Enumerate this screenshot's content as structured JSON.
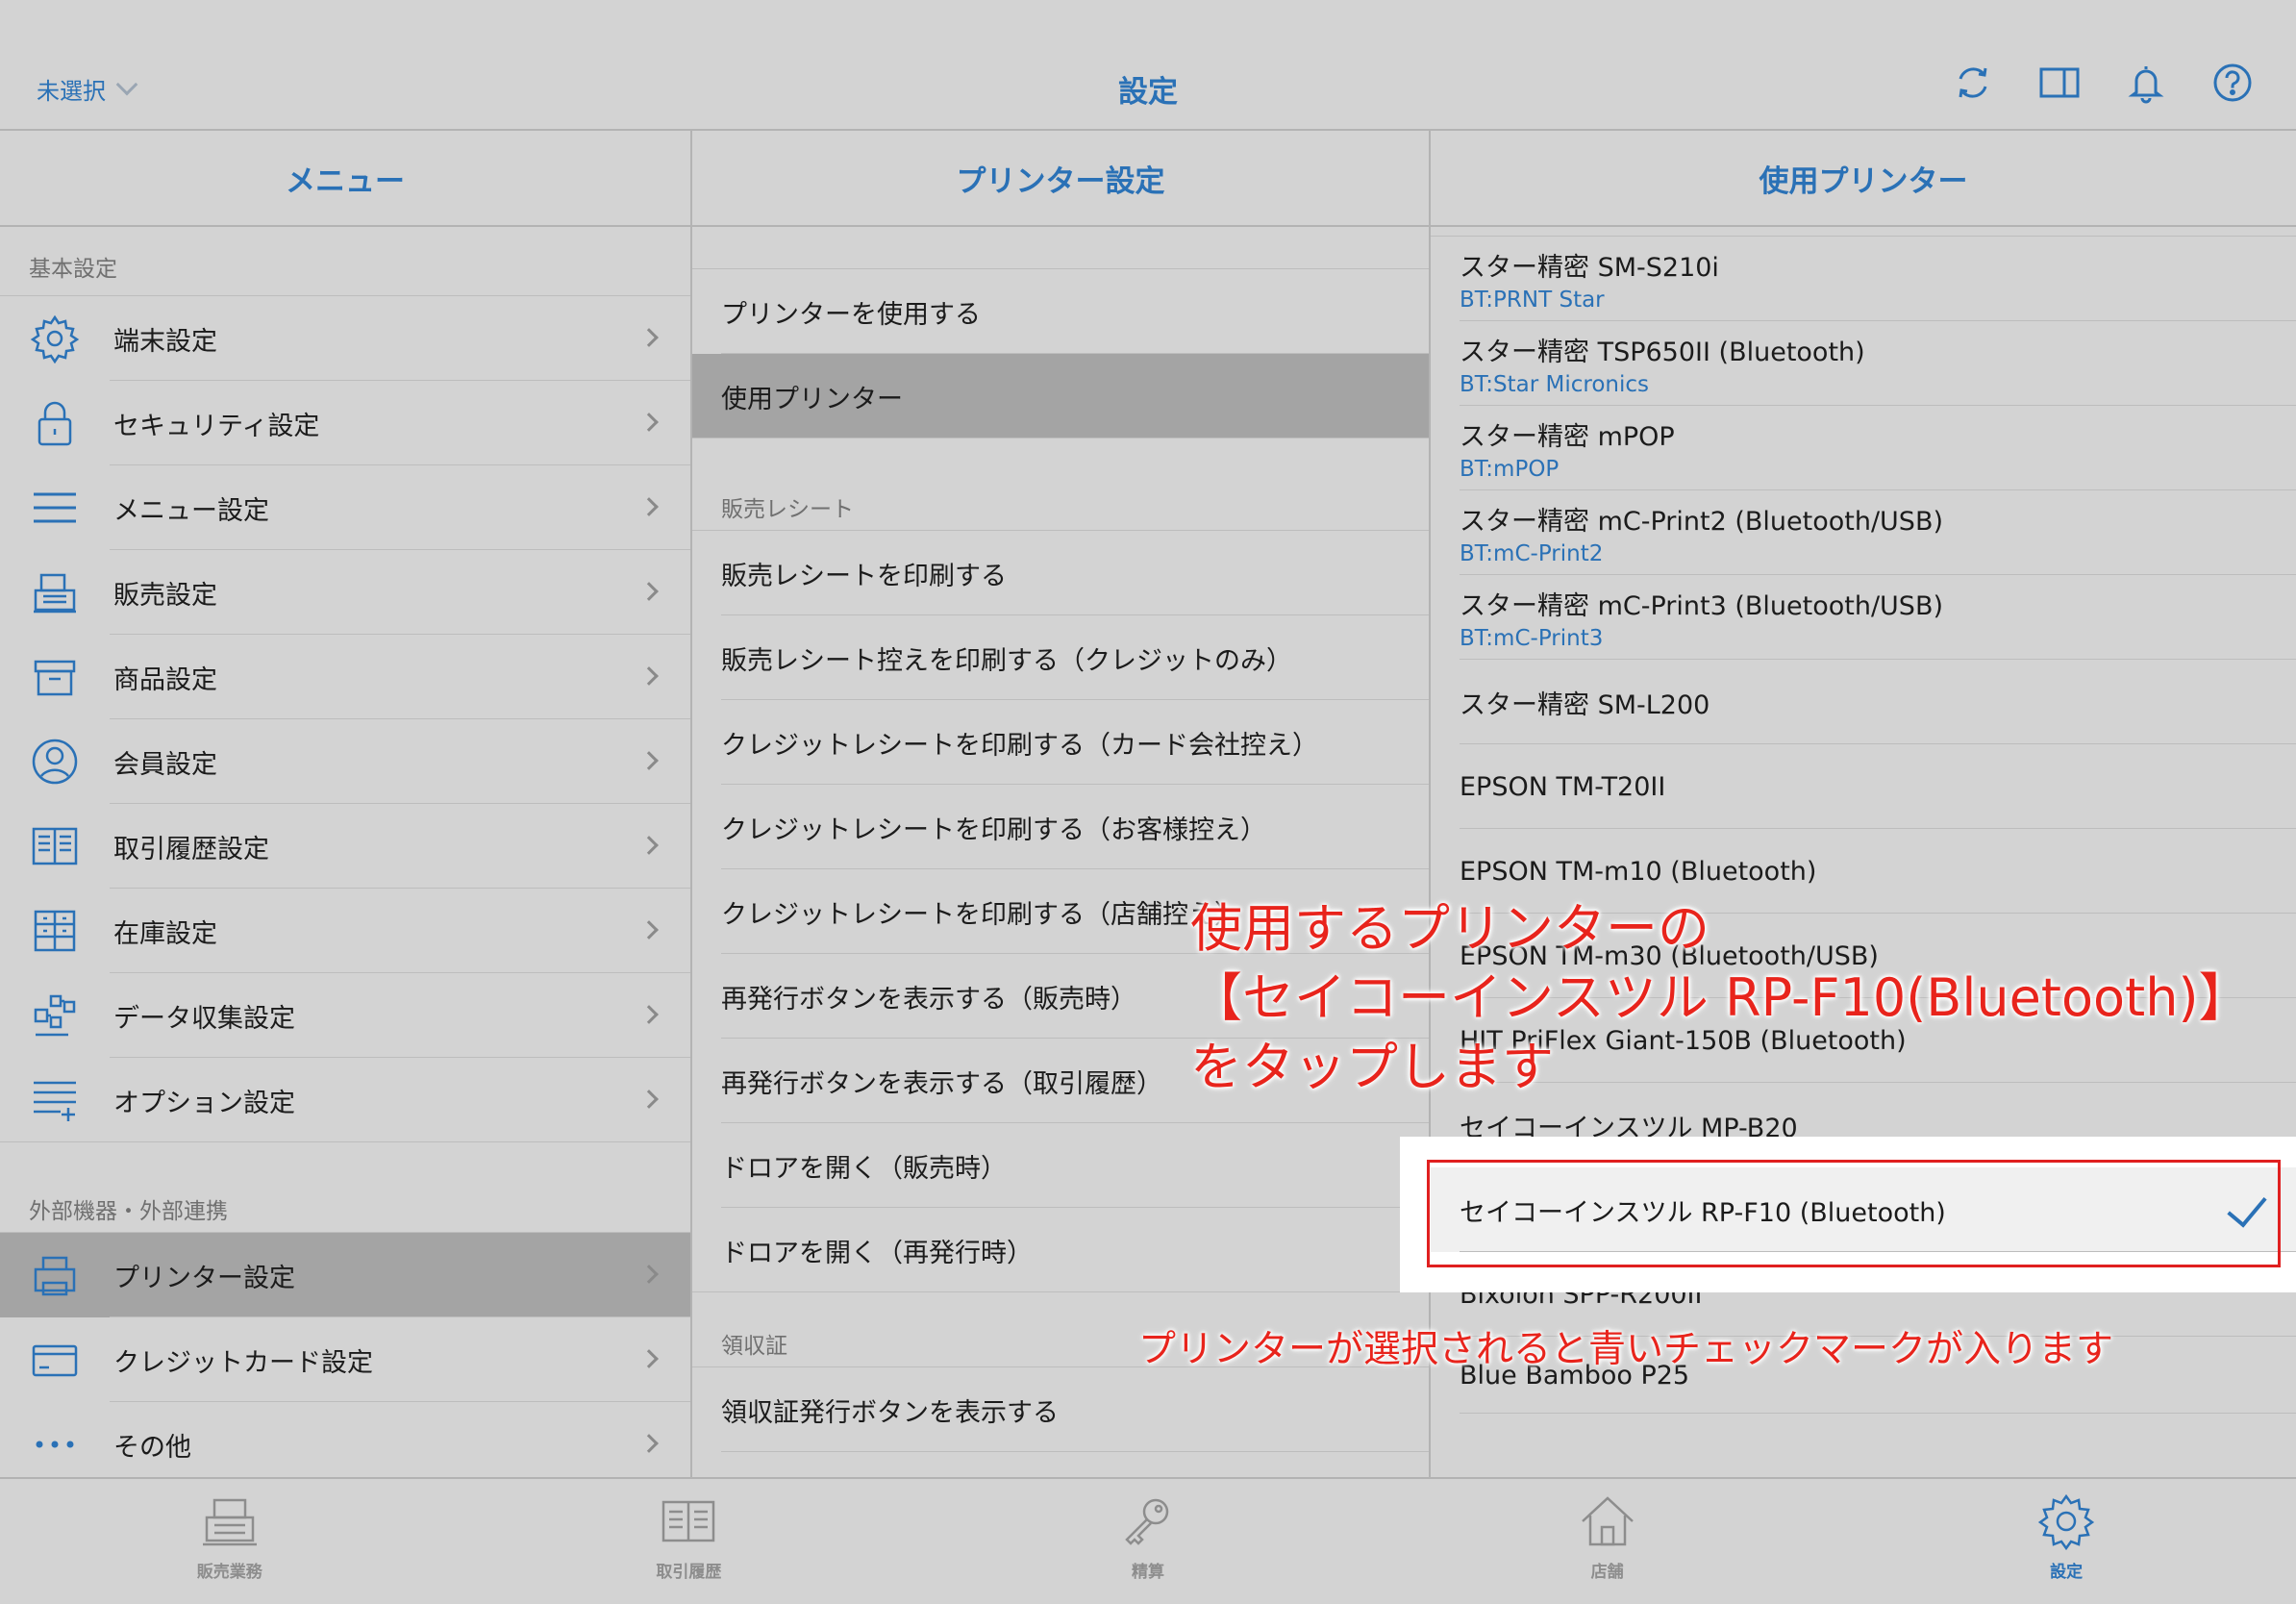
{
  "topbar": {
    "store_select": "未選択",
    "title": "設定",
    "icons": [
      "sync-icon",
      "sidebar-toggle-icon",
      "bell-icon",
      "help-icon"
    ]
  },
  "menu": {
    "header": "メニュー",
    "section_basic": "基本設定",
    "section_external": "外部機器・外部連携",
    "basic_items": [
      {
        "label": "端末設定",
        "icon": "gear-icon"
      },
      {
        "label": "セキュリティ設定",
        "icon": "lock-icon"
      },
      {
        "label": "メニュー設定",
        "icon": "list-icon"
      },
      {
        "label": "販売設定",
        "icon": "register-icon"
      },
      {
        "label": "商品設定",
        "icon": "box-icon"
      },
      {
        "label": "会員設定",
        "icon": "person-icon"
      },
      {
        "label": "取引履歴設定",
        "icon": "book-icon"
      },
      {
        "label": "在庫設定",
        "icon": "cabinet-icon"
      },
      {
        "label": "データ収集設定",
        "icon": "data-icon"
      },
      {
        "label": "オプション設定",
        "icon": "list-plus-icon"
      }
    ],
    "external_items": [
      {
        "label": "プリンター設定",
        "icon": "printer-icon"
      },
      {
        "label": "クレジットカード設定",
        "icon": "credit-card-icon"
      },
      {
        "label": "その他",
        "icon": "more-icon"
      }
    ]
  },
  "printer_settings": {
    "header": "プリンター設定",
    "top_items": [
      "プリンターを使用する",
      "使用プリンター"
    ],
    "section_receipt": "販売レシート",
    "receipt_items": [
      "販売レシートを印刷する",
      "販売レシート控えを印刷する（クレジットのみ）",
      "クレジットレシートを印刷する（カード会社控え）",
      "クレジットレシートを印刷する（お客様控え）",
      "クレジットレシートを印刷する（店舗控え）",
      "再発行ボタンを表示する（販売時）",
      "再発行ボタンを表示する（取引履歴）",
      "ドロアを開く（販売時）",
      "ドロアを開く（再発行時）"
    ],
    "section_invoice": "領収証",
    "invoice_items": [
      "領収証発行ボタンを表示する"
    ]
  },
  "printers": {
    "header": "使用プリンター",
    "items": [
      {
        "name": "スター精密 SM-S210i",
        "sub": "BT:PRNT Star"
      },
      {
        "name": "スター精密 TSP650II (Bluetooth)",
        "sub": "BT:Star Micronics"
      },
      {
        "name": "スター精密 mPOP",
        "sub": "BT:mPOP"
      },
      {
        "name": "スター精密 mC-Print2 (Bluetooth/USB)",
        "sub": "BT:mC-Print2"
      },
      {
        "name": "スター精密 mC-Print3 (Bluetooth/USB)",
        "sub": "BT:mC-Print3"
      },
      {
        "name": "スター精密 SM-L200",
        "sub": ""
      },
      {
        "name": "EPSON TM-T20II",
        "sub": ""
      },
      {
        "name": "EPSON TM-m10 (Bluetooth)",
        "sub": ""
      },
      {
        "name": "EPSON TM-m30 (Bluetooth/USB)",
        "sub": ""
      },
      {
        "name": "HIT PriFlex Giant-150B (Bluetooth)",
        "sub": ""
      },
      {
        "name": "セイコーインスツル MP-B20",
        "sub": ""
      },
      {
        "name": "セイコーインスツル RP-F10 (Bluetooth)",
        "sub": "",
        "checked": true
      },
      {
        "name": "Bixolon SPP-R200II",
        "sub": ""
      },
      {
        "name": "Blue Bamboo P25",
        "sub": ""
      }
    ]
  },
  "annotations": {
    "main_line1": "使用するプリンターの",
    "main_line2": "【セイコーインスツル RP-F10(Bluetooth)】",
    "main_line3": "をタップします",
    "sub": "プリンターが選択されると青いチェックマークが入ります",
    "color": "#e8241c"
  },
  "tabbar": {
    "items": [
      {
        "label": "販売業務",
        "icon": "register-icon"
      },
      {
        "label": "取引履歴",
        "icon": "book-icon"
      },
      {
        "label": "精算",
        "icon": "key-icon"
      },
      {
        "label": "店舗",
        "icon": "house-icon"
      },
      {
        "label": "設定",
        "icon": "gear-icon",
        "active": true
      }
    ]
  },
  "colors": {
    "accent": "#2a71b6",
    "selected_row": "#a4a4a4",
    "annotation": "#e8241c"
  }
}
